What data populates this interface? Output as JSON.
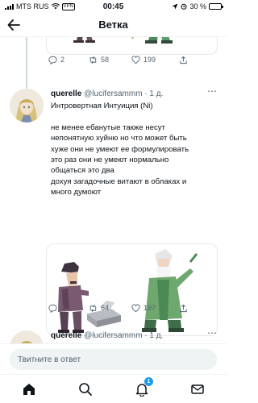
{
  "status_bar": {
    "carrier": "MTS RUS",
    "vpn_label": "VPN",
    "time": "00:45",
    "battery": "30 %",
    "battery_level": 0.3
  },
  "header": {
    "title": "Ветка"
  },
  "top_tweet": {
    "counts": {
      "replies": "2",
      "retweets": "58",
      "likes": "199"
    }
  },
  "tweet": {
    "display_name": "querelle",
    "meta": "@lucifersammm · 1 д.",
    "lines": [
      "Интровертная Интуиция (Ni)",
      "",
      "не менее ебанутые также несут",
      "непонятную хуйню но что может быть",
      "хуже они не умеют ее формулировать",
      "это раз они не умеют нормально",
      "общаться это два",
      "дохуя загадочные витают в облаках и",
      "много думоют"
    ],
    "counts": {
      "replies": "2",
      "retweets": "64",
      "likes": "197"
    }
  },
  "next_tweet": {
    "display_name": "querelle",
    "meta": "@lucifersammm · 1 д."
  },
  "composer": {
    "placeholder": "Твитните в ответ"
  },
  "tabbar": {
    "notifications_badge": "1"
  },
  "colors": {
    "accent": "#1d9bf0",
    "text": "#0f1419",
    "muted": "#536471"
  }
}
